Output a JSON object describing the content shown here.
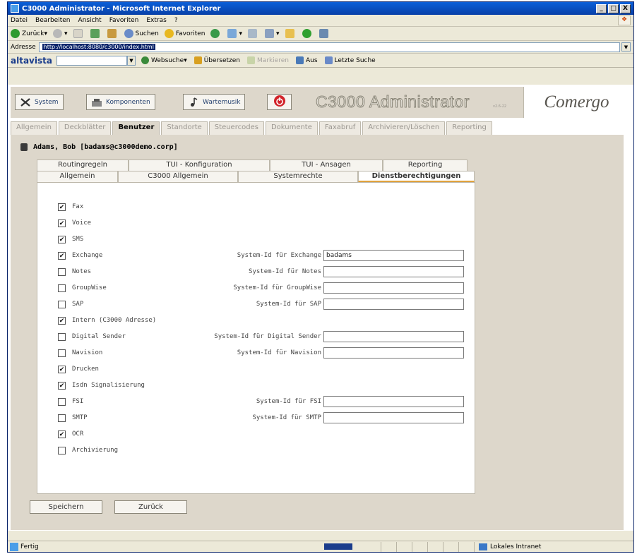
{
  "window": {
    "title": "C3000 Administrator - Microsoft Internet Explorer",
    "controls": [
      "_",
      "□",
      "X"
    ]
  },
  "menu": [
    "Datei",
    "Bearbeiten",
    "Ansicht",
    "Favoriten",
    "Extras",
    "?"
  ],
  "toolbar": {
    "back": "Zurück",
    "search": "Suchen",
    "favorites": "Favoriten"
  },
  "address": {
    "label": "Adresse",
    "url": "http://localhost:8080/c3000/index.html"
  },
  "altavista": {
    "logo": "altavista",
    "websearch": "Websuche",
    "translate": "Übersetzen",
    "mark": "Markieren",
    "off": "Aus",
    "last_search": "Letzte Suche"
  },
  "app": {
    "buttons": {
      "system": "System",
      "components": "Komponenten",
      "waiting_music": "Wartemusik"
    },
    "title": "C3000 Administrator",
    "version": "v2.6-22",
    "brand": "Comergo"
  },
  "main_tabs": [
    {
      "label": "Allgemein",
      "active": false
    },
    {
      "label": "Deckblätter",
      "active": false
    },
    {
      "label": "Benutzer",
      "active": true
    },
    {
      "label": "Standorte",
      "active": false
    },
    {
      "label": "Steuercodes",
      "active": false
    },
    {
      "label": "Dokumente",
      "active": false
    },
    {
      "label": "Faxabruf",
      "active": false
    },
    {
      "label": "Archivieren/Löschen",
      "active": false
    },
    {
      "label": "Reporting",
      "active": false
    }
  ],
  "user": {
    "name": "Adams, Bob [badams@c3000demo.corp]"
  },
  "sub_tabs_row1": [
    "Routingregeln",
    "TUI - Konfiguration",
    "TUI - Ansagen",
    "Reporting"
  ],
  "sub_tabs_row2": [
    {
      "label": "Allgemein",
      "active": false
    },
    {
      "label": "C3000 Allgemein",
      "active": false
    },
    {
      "label": "Systemrechte",
      "active": false
    },
    {
      "label": "Dienstberechtigungen",
      "active": true
    }
  ],
  "permissions": [
    {
      "label": "Fax",
      "checked": true
    },
    {
      "label": "Voice",
      "checked": true
    },
    {
      "label": "SMS",
      "checked": true
    },
    {
      "label": "Exchange",
      "checked": true,
      "field_label": "System-Id für Exchange",
      "field_value": "badams"
    },
    {
      "label": "Notes",
      "checked": false,
      "field_label": "System-Id für Notes",
      "field_value": ""
    },
    {
      "label": "GroupWise",
      "checked": false,
      "field_label": "System-Id für GroupWise",
      "field_value": ""
    },
    {
      "label": "SAP",
      "checked": false,
      "field_label": "System-Id für SAP",
      "field_value": ""
    },
    {
      "label": "Intern (C3000 Adresse)",
      "checked": true
    },
    {
      "label": "Digital Sender",
      "checked": false,
      "field_label": "System-Id für Digital Sender",
      "field_value": ""
    },
    {
      "label": "Navision",
      "checked": false,
      "field_label": "System-Id für Navision",
      "field_value": ""
    },
    {
      "label": "Drucken",
      "checked": true
    },
    {
      "label": "Isdn Signalisierung",
      "checked": true
    },
    {
      "label": "FSI",
      "checked": false,
      "field_label": "System-Id für FSI",
      "field_value": ""
    },
    {
      "label": "SMTP",
      "checked": false,
      "field_label": "System-Id für SMTP",
      "field_value": ""
    },
    {
      "label": "OCR",
      "checked": true
    },
    {
      "label": "Archivierung",
      "checked": false
    }
  ],
  "actions": {
    "save": "Speichern",
    "back": "Zurück"
  },
  "status": {
    "text": "Fertig",
    "zone": "Lokales Intranet"
  },
  "colors": {
    "titlebar": "#0840a8",
    "app_bg": "#ddd7cb",
    "active_tab_underline": "#e0a23c"
  }
}
